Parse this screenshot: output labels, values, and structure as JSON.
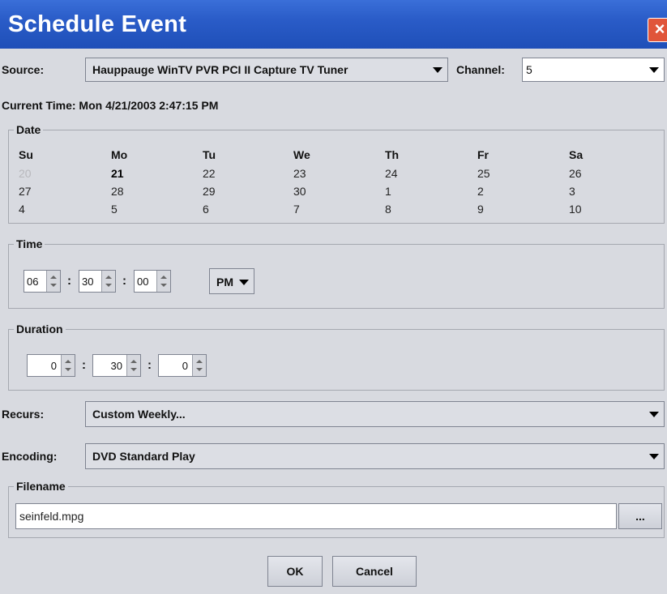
{
  "window": {
    "title": "Schedule Event",
    "close_icon": "close-icon"
  },
  "source": {
    "label": "Source:",
    "value": "Hauppauge WinTV PVR PCI II Capture TV Tuner"
  },
  "channel": {
    "label": "Channel:",
    "value": "5"
  },
  "current_time": "Current Time: Mon 4/21/2003 2:47:15 PM",
  "date": {
    "title": "Date",
    "headers": [
      "Su",
      "Mo",
      "Tu",
      "We",
      "Th",
      "Fr",
      "Sa"
    ],
    "weeks": [
      [
        "20",
        "21",
        "22",
        "23",
        "24",
        "25",
        "26"
      ],
      [
        "27",
        "28",
        "29",
        "30",
        "1",
        "2",
        "3"
      ],
      [
        "4",
        "5",
        "6",
        "7",
        "8",
        "9",
        "10"
      ]
    ]
  },
  "time": {
    "title": "Time",
    "hours": "06",
    "minutes": "30",
    "seconds": "00",
    "ampm": "PM",
    "separator": ":"
  },
  "duration": {
    "title": "Duration",
    "hours": "0",
    "minutes": "30",
    "seconds": "0",
    "separator": ":"
  },
  "recurs": {
    "label": "Recurs:",
    "value": "Custom Weekly..."
  },
  "encoding": {
    "label": "Encoding:",
    "value": "DVD Standard Play"
  },
  "filename": {
    "title": "Filename",
    "value": "seinfeld.mpg",
    "browse_label": "..."
  },
  "buttons": {
    "ok": "OK",
    "cancel": "Cancel"
  }
}
